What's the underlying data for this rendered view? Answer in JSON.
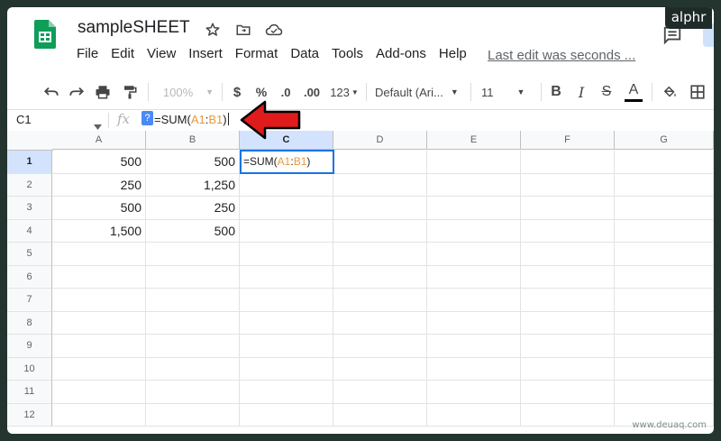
{
  "watermark_brand": "alphr",
  "footer_watermark": "www.deuaq.com",
  "app": {
    "title": "sampleSHEET",
    "last_edit": "Last edit was seconds ..."
  },
  "menu": [
    "File",
    "Edit",
    "View",
    "Insert",
    "Format",
    "Data",
    "Tools",
    "Add-ons",
    "Help"
  ],
  "toolbar": {
    "zoom": "100%",
    "currency": "$",
    "percent": "%",
    "dec_decrease": ".0",
    "dec_increase": ".00",
    "more_formats": "123",
    "font": "Default (Ari...",
    "font_size": "11",
    "bold": "B",
    "italic": "I",
    "strike": "S",
    "text_color": "A"
  },
  "formula_bar": {
    "name_box": "C1",
    "fx": "fx",
    "help": "?",
    "prefix": "=SUM(",
    "ref1": "A1",
    "colon": ":",
    "ref2": "B1",
    "suffix": ")"
  },
  "grid": {
    "columns": [
      "A",
      "B",
      "C",
      "D",
      "E",
      "F",
      "G"
    ],
    "rows": [
      "1",
      "2",
      "3",
      "4",
      "5",
      "6",
      "7",
      "8",
      "9",
      "10",
      "11",
      "12"
    ],
    "cells": {
      "A": [
        "500",
        "250",
        "500",
        "1,500"
      ],
      "B": [
        "500",
        "1,250",
        "250",
        "500"
      ]
    },
    "active_cell": {
      "prefix": "=SUM(",
      "ref1": "A1",
      "colon": ":",
      "ref2": "B1",
      "suffix": ")"
    }
  },
  "colors": {
    "accent": "#1a73e8",
    "range_ref": "#e8983c",
    "logo_green": "#0f9d58",
    "arrow_red": "#e01b1b"
  }
}
